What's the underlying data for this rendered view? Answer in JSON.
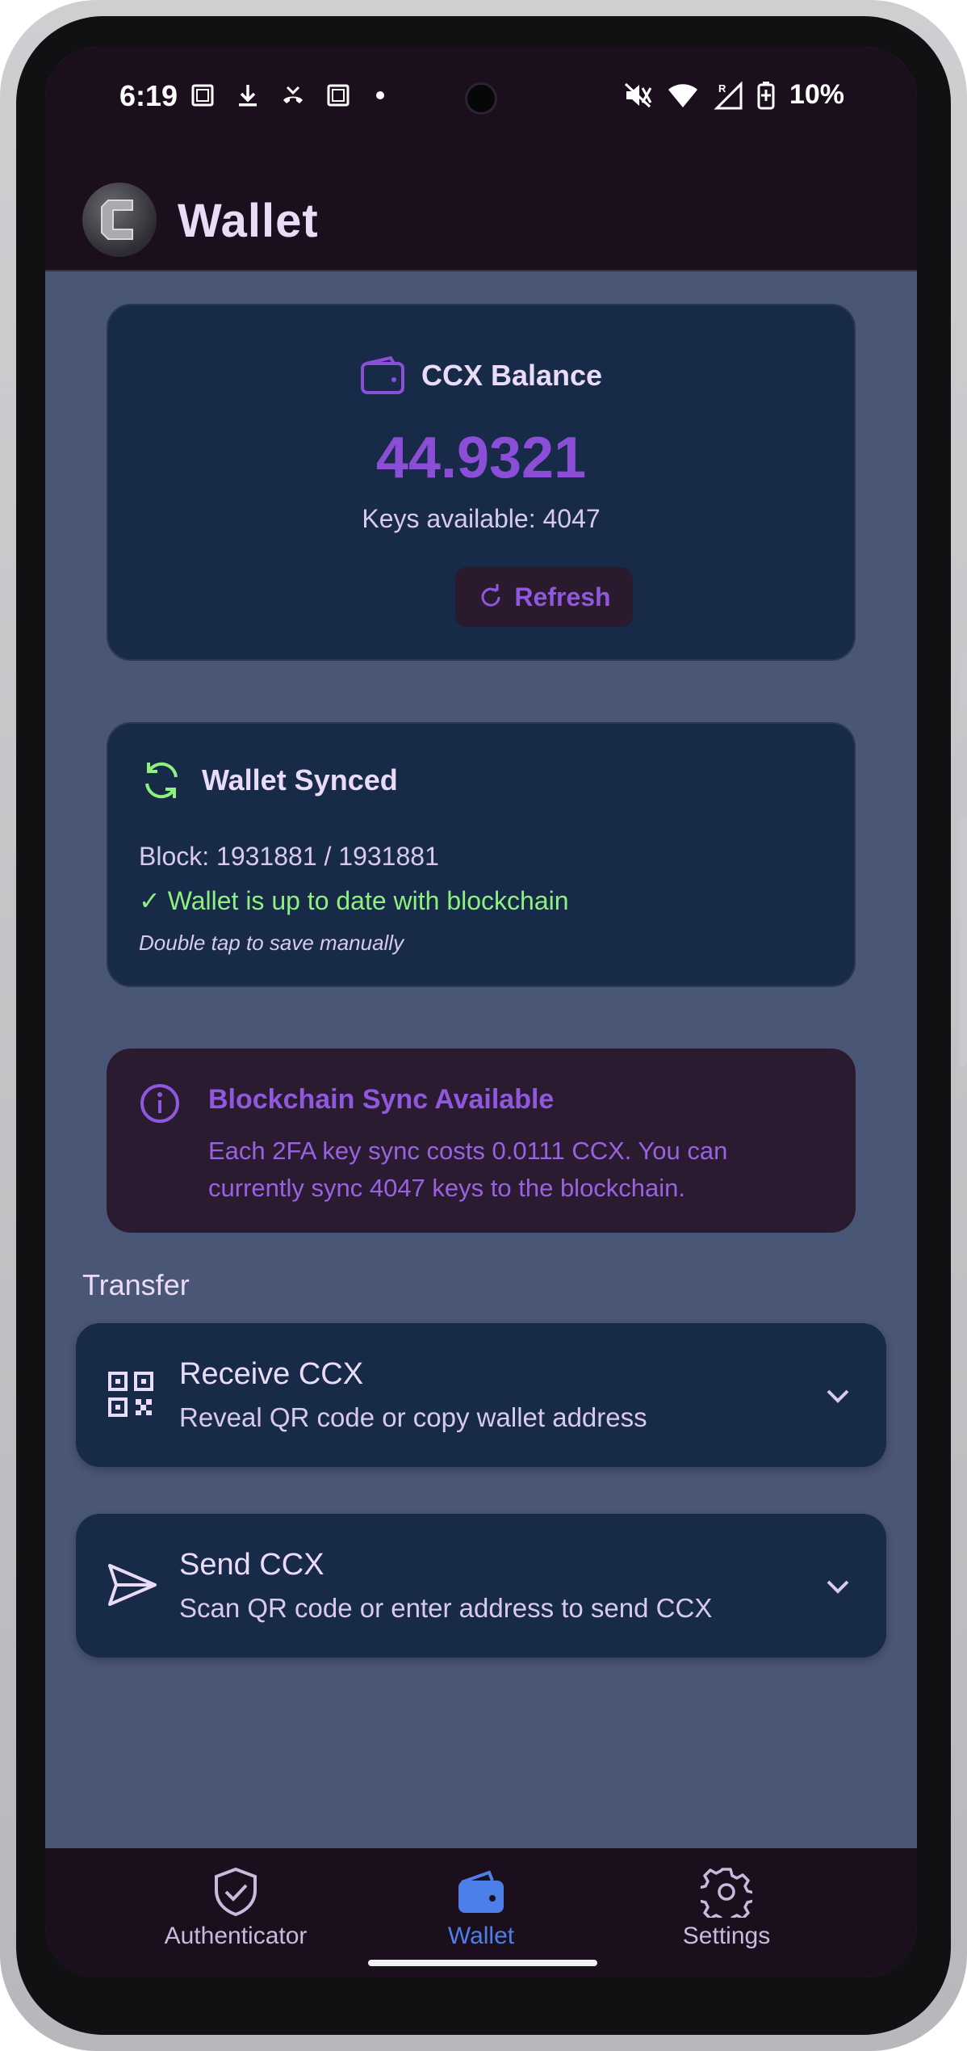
{
  "status_bar": {
    "time": "6:19",
    "battery": "10%"
  },
  "app_bar": {
    "title": "Wallet",
    "logo_icon": "c-logo-icon"
  },
  "balance_card": {
    "label": "CCX Balance",
    "amount": "44.9321",
    "keys_available": "Keys available: 4047",
    "refresh_label": "Refresh"
  },
  "sync_card": {
    "title": "Wallet Synced",
    "block": "Block: 1931881 / 1931881",
    "status": "✓ Wallet is up to date with blockchain",
    "hint": "Double tap to save manually"
  },
  "info_card": {
    "title": "Blockchain Sync Available",
    "text": "Each 2FA key sync costs 0.0111 CCX. You can currently sync 4047 keys to the blockchain."
  },
  "transfer": {
    "section_label": "Transfer",
    "receive": {
      "title": "Receive CCX",
      "subtitle": "Reveal QR code or copy wallet address"
    },
    "send": {
      "title": "Send CCX",
      "subtitle": "Scan QR code or enter address to send CCX"
    }
  },
  "bottom_nav": {
    "items": [
      {
        "label": "Authenticator",
        "icon": "shield-check-icon",
        "active": false
      },
      {
        "label": "Wallet",
        "icon": "wallet-icon",
        "active": true
      },
      {
        "label": "Settings",
        "icon": "gear-icon",
        "active": false
      }
    ]
  },
  "colors": {
    "background": "#4a5675",
    "card": "#172a47",
    "accent_purple": "#8a4fd6",
    "success_green": "#8ef07e",
    "nav_active": "#4d7fe8"
  }
}
